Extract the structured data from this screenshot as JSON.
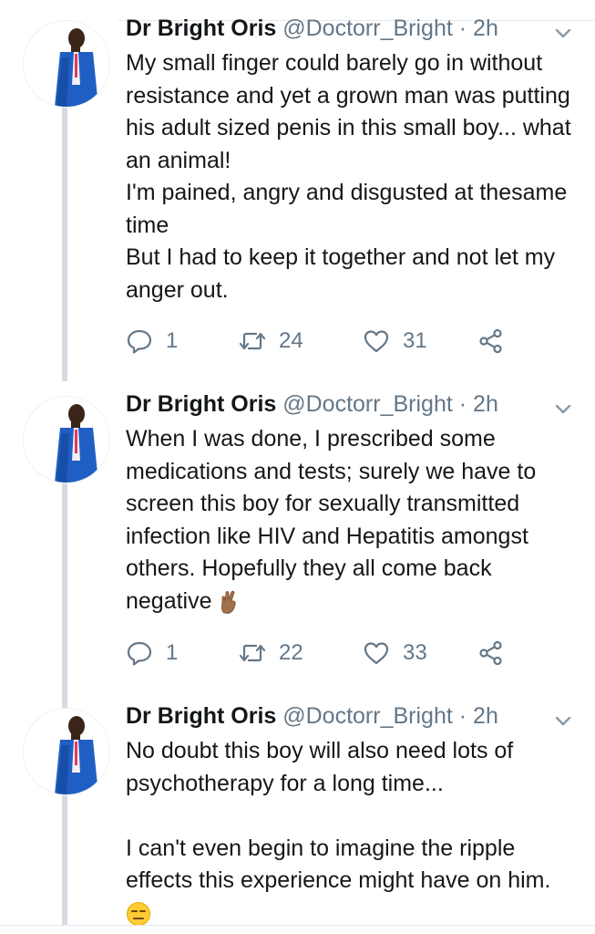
{
  "tweets": [
    {
      "name": "Dr Bright Oris",
      "handle": "@Doctorr_Bright",
      "separator": "·",
      "time": "2h",
      "text": "My small finger could barely go in without resistance and yet a grown man was putting his adult sized penis in this small boy... what an animal!\nI'm pained, angry and disgusted at thesame time\nBut I had to keep it together and not let my anger out.",
      "replies": "1",
      "retweets": "24",
      "likes": "31"
    },
    {
      "name": "Dr Bright Oris",
      "handle": "@Doctorr_Bright",
      "separator": "·",
      "time": "2h",
      "text": "When I was done, I prescribed some medications and tests; surely we have to screen this boy for sexually transmitted infection like HIV and Hepatitis amongst others. Hopefully they all come back negative",
      "emoji": "crossed-fingers-emoji",
      "replies": "1",
      "retweets": "22",
      "likes": "33"
    },
    {
      "name": "Dr Bright Oris",
      "handle": "@Doctorr_Bright",
      "separator": "·",
      "time": "2h",
      "text": "No doubt this boy will also need lots of psychotherapy for a long time...\n\nI can't even begin to imagine the ripple effects this experience might have on him.",
      "emoji": "expressionless-face-emoji"
    }
  ],
  "colors": {
    "text": "#14171a",
    "secondary": "#657786",
    "thread_line": "#d5dde3",
    "divider": "#e1e8ed",
    "suit_blue": "#1f5fc4"
  },
  "icons": [
    "reply-icon",
    "retweet-icon",
    "like-icon",
    "share-icon",
    "caret-down-icon"
  ]
}
